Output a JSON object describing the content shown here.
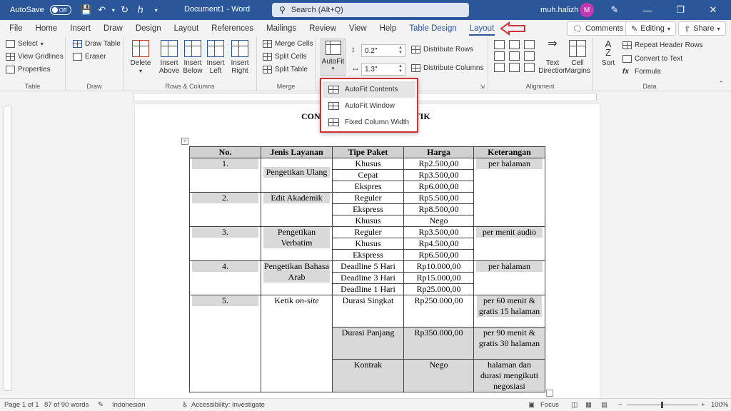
{
  "titlebar": {
    "autosave_label": "AutoSave",
    "autosave_state": "Off",
    "document_title": "Document1",
    "separator": "-",
    "app_name": "Word",
    "search_placeholder": "Search (Alt+Q)",
    "user_name": "muh.halizh",
    "avatar_initial": "M"
  },
  "tabs": [
    "File",
    "Home",
    "Insert",
    "Draw",
    "Design",
    "Layout",
    "References",
    "Mailings",
    "Review",
    "View",
    "Help",
    "Table Design",
    "Layout"
  ],
  "right_buttons": {
    "comments": "Comments",
    "editing": "Editing",
    "share": "Share"
  },
  "ribbon": {
    "table": {
      "label": "Table",
      "select": "Select",
      "gridlines": "View Gridlines",
      "properties": "Properties"
    },
    "draw": {
      "label": "Draw",
      "draw_table": "Draw Table",
      "eraser": "Eraser"
    },
    "rows_columns": {
      "label": "Rows & Columns",
      "delete": "Delete",
      "insert_above": "Insert Above",
      "insert_below": "Insert Below",
      "insert_left": "Insert Left",
      "insert_right": "Insert Right"
    },
    "merge": {
      "label": "Merge",
      "merge_cells": "Merge Cells",
      "split_cells": "Split Cells",
      "split_table": "Split Table"
    },
    "cell_size": {
      "autofit": "AutoFit",
      "height": "0.2\"",
      "width": "1.3\"",
      "distribute_rows": "Distribute Rows",
      "distribute_columns": "Distribute Columns"
    },
    "alignment": {
      "label": "Alignment",
      "text_direction": "Text Direction",
      "cell_margins": "Cell Margins"
    },
    "data": {
      "label": "Data",
      "sort": "Sort",
      "repeat_header": "Repeat Header Rows",
      "convert": "Convert to Text",
      "formula": "Formula"
    }
  },
  "autofit_menu": {
    "items": [
      "AutoFit Contents",
      "AutoFit Window",
      "Fixed Column Width"
    ]
  },
  "document": {
    "title_left": "CON",
    "title_right": "TIK",
    "table": {
      "headers": [
        "No.",
        "Jenis Layanan",
        "Tipe Paket",
        "Harga",
        "Keterangan"
      ],
      "r1": {
        "no": "1.",
        "layanan": "Pengetikan Ulang",
        "ket": "per halaman",
        "paket": [
          "Khusus",
          "Cepat",
          "Ekspres"
        ],
        "harga": [
          "Rp2.500,00",
          "Rp3.500,00",
          "Rp6.000,00"
        ]
      },
      "r2": {
        "no": "2.",
        "layanan": "Edit Akademik",
        "paket": [
          "Reguler",
          "Ekspress",
          "Khusus"
        ],
        "harga": [
          "Rp5.500,00",
          "Rp8.500,00",
          "Nego"
        ]
      },
      "r3": {
        "no": "3.",
        "layanan": "Pengetikan Verbatim",
        "ket": "per menit audio",
        "paket": [
          "Reguler",
          "Khusus",
          "Ekspress"
        ],
        "harga": [
          "Rp3.500,00",
          "Rp4.500,00",
          "Rp6.500,00"
        ]
      },
      "r4": {
        "no": "4.",
        "layanan": "Pengetikan Bahasa Arab",
        "ket": "per halaman",
        "paket": [
          "Deadline 5 Hari",
          "Deadline 3 Hari",
          "Deadline 1 Hari"
        ],
        "harga": [
          "Rp10.000,00",
          "Rp15.000,00",
          "Rp25.000,00"
        ]
      },
      "r5": {
        "no": "5.",
        "layanan_a": "Ketik ",
        "layanan_b": "on-site",
        "sub": [
          {
            "paket": "Durasi Singkat",
            "harga": "Rp250.000,00",
            "ket": "per 60 menit & gratis 15 halaman"
          },
          {
            "paket": "Durasi Panjang",
            "harga": "Rp350.000,00",
            "ket": "per 90 menit & gratis 30 halaman"
          },
          {
            "paket": "Kontrak",
            "harga": "Nego",
            "ket": "halaman dan durasi mengikuti negosiasi"
          }
        ]
      }
    }
  },
  "statusbar": {
    "page": "Page 1 of 1",
    "words": "87 of 90 words",
    "language": "Indonesian",
    "accessibility": "Accessibility: Investigate",
    "focus": "Focus",
    "zoom": "100%"
  }
}
